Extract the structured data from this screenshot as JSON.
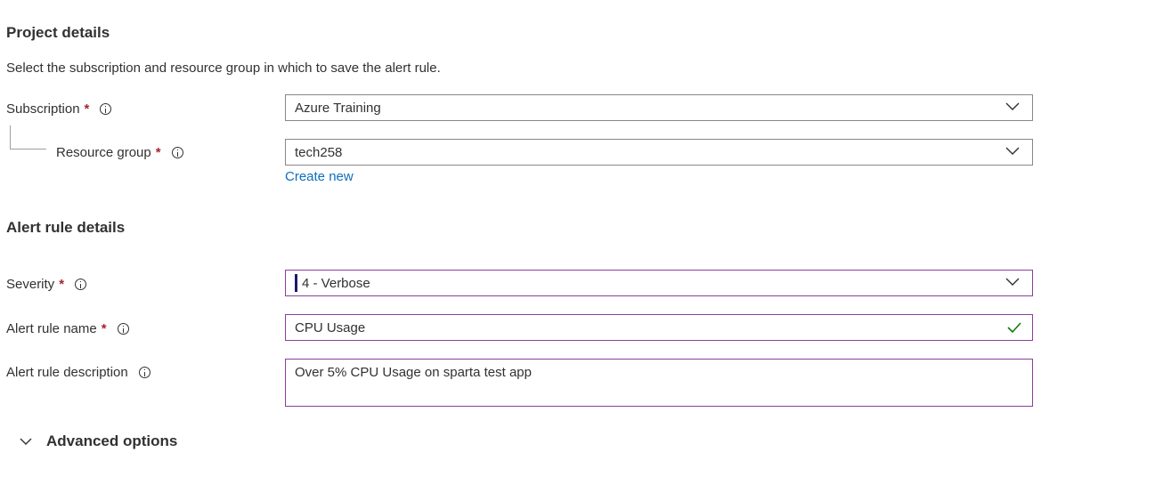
{
  "project_details": {
    "title": "Project details",
    "description": "Select the subscription and resource group in which to save the alert rule.",
    "subscription": {
      "label": "Subscription",
      "required_mark": "*",
      "value": "Azure Training"
    },
    "resource_group": {
      "label": "Resource group",
      "required_mark": "*",
      "value": "tech258",
      "create_new_link": "Create new"
    }
  },
  "alert_rule_details": {
    "title": "Alert rule details",
    "severity": {
      "label": "Severity",
      "required_mark": "*",
      "value": "4 - Verbose",
      "bar_color": "#1b1a6f"
    },
    "name": {
      "label": "Alert rule name",
      "required_mark": "*",
      "value": "CPU Usage",
      "valid_icon": "checkmark-icon"
    },
    "description": {
      "label": "Alert rule description",
      "value": "Over 5% CPU Usage on sparta test app"
    }
  },
  "advanced_options": {
    "label": "Advanced options"
  },
  "colors": {
    "required": "#a4262c",
    "link": "#0f6cbd",
    "focus_border": "#8a3f9c",
    "valid_check": "#107c10"
  }
}
